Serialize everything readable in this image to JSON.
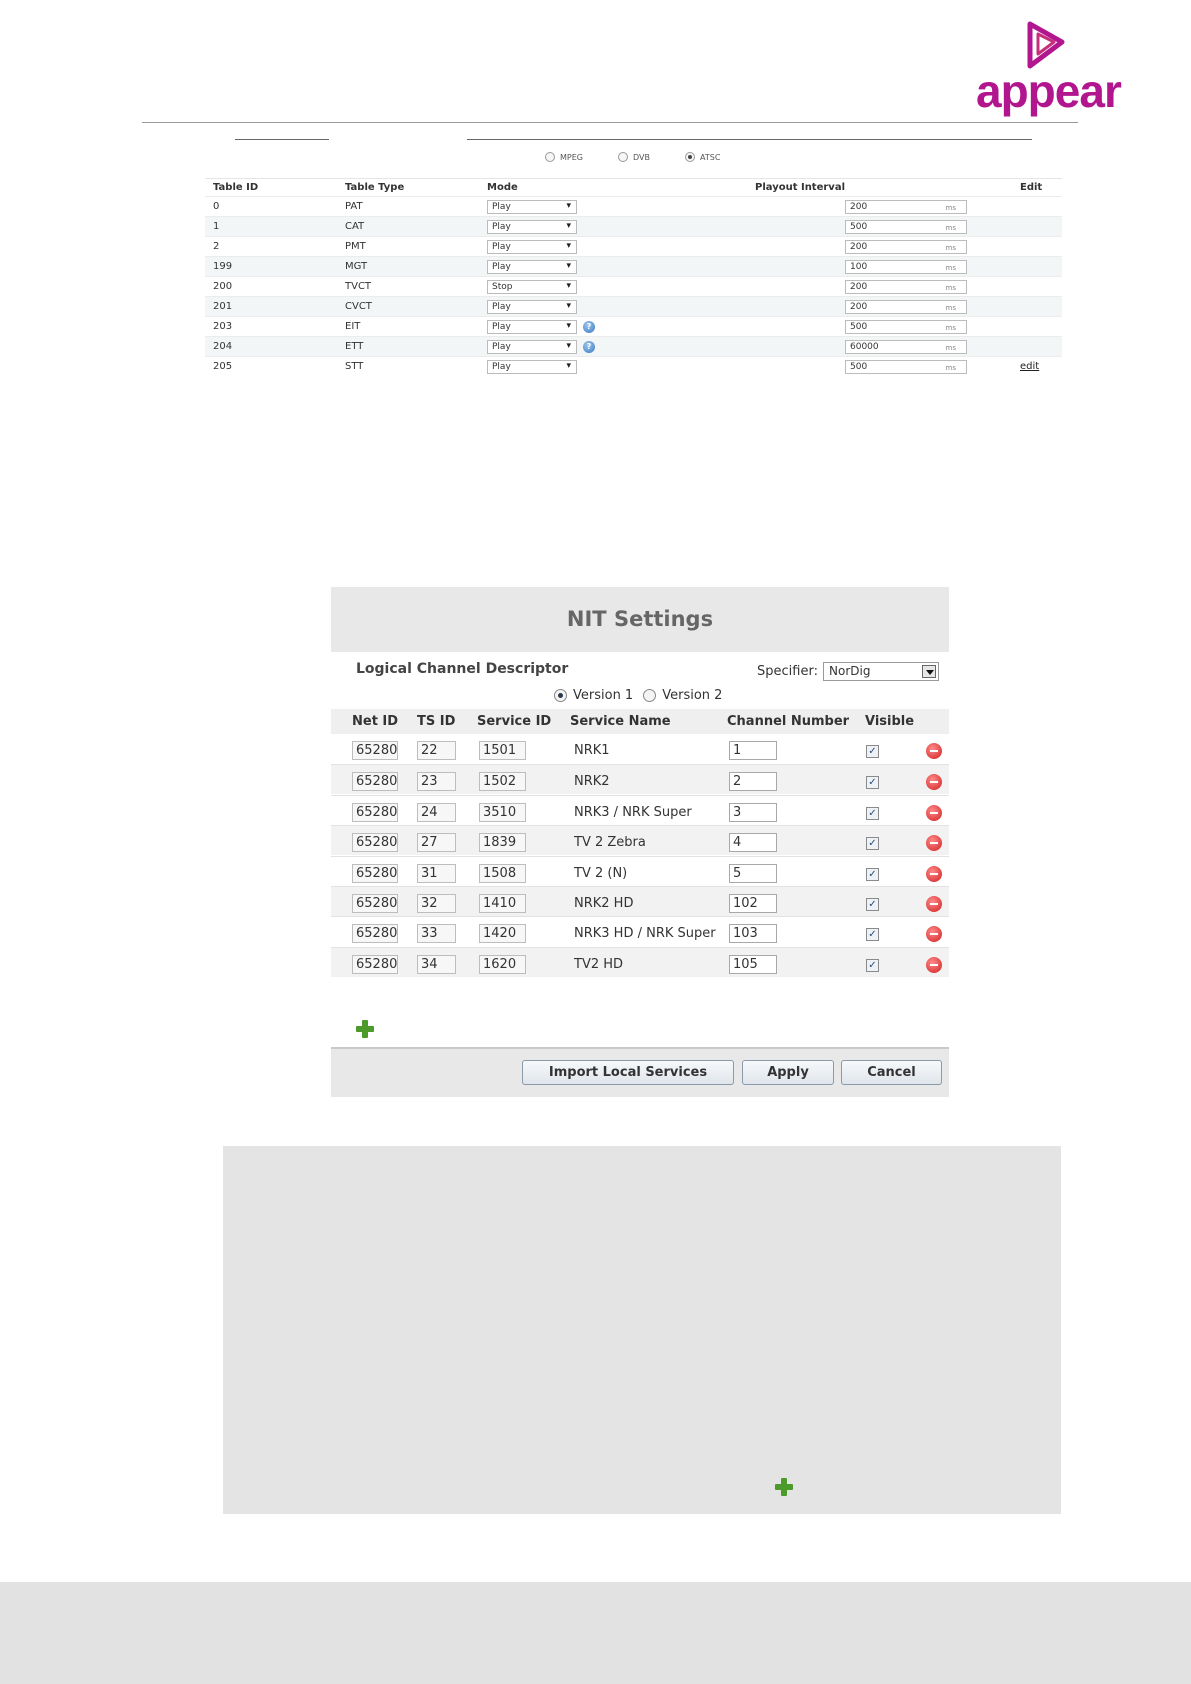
{
  "brand": {
    "name": "appear",
    "color": "#b2168f"
  },
  "standards": {
    "options": [
      "MPEG",
      "DVB",
      "ATSC"
    ],
    "selected": "ATSC"
  },
  "psi_table": {
    "headers": {
      "table_id": "Table ID",
      "table_type": "Table Type",
      "mode": "Mode",
      "playout_interval": "Playout Interval",
      "edit": "Edit"
    },
    "unit": "ms",
    "rows": [
      {
        "id": "0",
        "type": "PAT",
        "mode": "Play",
        "interval": "200",
        "help": false,
        "edit": ""
      },
      {
        "id": "1",
        "type": "CAT",
        "mode": "Play",
        "interval": "500",
        "help": false,
        "edit": ""
      },
      {
        "id": "2",
        "type": "PMT",
        "mode": "Play",
        "interval": "200",
        "help": false,
        "edit": ""
      },
      {
        "id": "199",
        "type": "MGT",
        "mode": "Play",
        "interval": "100",
        "help": false,
        "edit": ""
      },
      {
        "id": "200",
        "type": "TVCT",
        "mode": "Stop",
        "interval": "200",
        "help": false,
        "edit": ""
      },
      {
        "id": "201",
        "type": "CVCT",
        "mode": "Play",
        "interval": "200",
        "help": false,
        "edit": ""
      },
      {
        "id": "203",
        "type": "EIT",
        "mode": "Play",
        "interval": "500",
        "help": true,
        "edit": ""
      },
      {
        "id": "204",
        "type": "ETT",
        "mode": "Play",
        "interval": "60000",
        "help": true,
        "edit": ""
      },
      {
        "id": "205",
        "type": "STT",
        "mode": "Play",
        "interval": "500",
        "help": false,
        "edit": "edit"
      }
    ]
  },
  "nit": {
    "title": "NIT Settings",
    "lcd_label": "Logical Channel Descriptor",
    "specifier_label": "Specifier:",
    "specifier_value": "NorDig",
    "version_1": "Version 1",
    "version_2": "Version 2",
    "selected_version": "Version 1",
    "headers": {
      "net_id": "Net ID",
      "ts_id": "TS ID",
      "service_id": "Service ID",
      "service_name": "Service Name",
      "channel_number": "Channel Number",
      "visible": "Visible"
    },
    "rows": [
      {
        "net_id": "65280",
        "ts_id": "22",
        "service_id": "1501",
        "service_name": "NRK1",
        "channel": "1",
        "visible": true
      },
      {
        "net_id": "65280",
        "ts_id": "23",
        "service_id": "1502",
        "service_name": "NRK2",
        "channel": "2",
        "visible": true
      },
      {
        "net_id": "65280",
        "ts_id": "24",
        "service_id": "3510",
        "service_name": "NRK3 / NRK Super",
        "channel": "3",
        "visible": true
      },
      {
        "net_id": "65280",
        "ts_id": "27",
        "service_id": "1839",
        "service_name": "TV 2 Zebra",
        "channel": "4",
        "visible": true
      },
      {
        "net_id": "65280",
        "ts_id": "31",
        "service_id": "1508",
        "service_name": "TV 2 (N)",
        "channel": "5",
        "visible": true
      },
      {
        "net_id": "65280",
        "ts_id": "32",
        "service_id": "1410",
        "service_name": "NRK2 HD",
        "channel": "102",
        "visible": true
      },
      {
        "net_id": "65280",
        "ts_id": "33",
        "service_id": "1420",
        "service_name": "NRK3 HD / NRK Super",
        "channel": "103",
        "visible": true
      },
      {
        "net_id": "65280",
        "ts_id": "34",
        "service_id": "1620",
        "service_name": "TV2 HD",
        "channel": "105",
        "visible": true
      }
    ],
    "buttons": {
      "import": "Import Local Services",
      "apply": "Apply",
      "cancel": "Cancel"
    }
  },
  "icons": {
    "add": "plus-icon",
    "remove": "remove-icon",
    "help": "help-icon",
    "check": "checkbox-checked"
  }
}
